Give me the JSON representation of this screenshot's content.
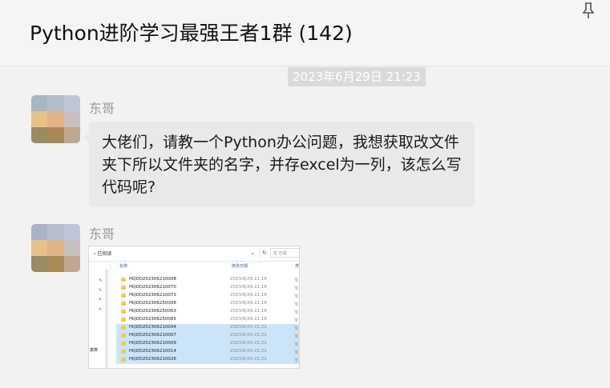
{
  "window": {
    "title": "Python进阶学习最强王者1群 (142)",
    "pin_icon": "pin-icon"
  },
  "timestamp": "2023年6月29日 21:23",
  "messages": [
    {
      "sender": "东哥",
      "avatar_icon": "blurred-avatar",
      "text": "大佬们，请教一个Python办公问题，我想获取改文件夹下所以文件夹的名字，并存excel为一列，该怎么写代码呢?"
    },
    {
      "sender": "东哥",
      "avatar_icon": "blurred-avatar",
      "image": {
        "path": "‹ 已阅读",
        "search_placeholder": "在 已阅",
        "nav_text": "撤算",
        "col_name": "名称",
        "col_date": "修改日期",
        "col_type": "类",
        "rows": [
          {
            "name": "HQDD202306210008",
            "date": "2023/6/29 21:19",
            "type": "文",
            "selected": false
          },
          {
            "name": "HQDD202306210070",
            "date": "2023/6/29 21:19",
            "type": "文",
            "selected": false
          },
          {
            "name": "HQDD202306210073",
            "date": "2023/6/29 21:19",
            "type": "文",
            "selected": false
          },
          {
            "name": "HQDD202306250008",
            "date": "2023/6/29 21:19",
            "type": "文",
            "selected": false
          },
          {
            "name": "HQDD202306250063",
            "date": "2023/6/29 21:19",
            "type": "文",
            "selected": false
          },
          {
            "name": "HQDD202306250065",
            "date": "2023/6/29 21:19",
            "type": "文",
            "selected": false
          },
          {
            "name": "HQDD202306210004",
            "date": "2023/6/29 21:21",
            "type": "文",
            "selected": true
          },
          {
            "name": "HQDD202306210007",
            "date": "2023/6/29 21:21",
            "type": "文",
            "selected": true
          },
          {
            "name": "HQDD202306210009",
            "date": "2023/6/29 21:21",
            "type": "文",
            "selected": true
          },
          {
            "name": "HQDD202306210014",
            "date": "2023/6/29 21:21",
            "type": "文",
            "selected": true
          },
          {
            "name": "HQDD202306210026",
            "date": "2023/6/29 21:21",
            "type": "文",
            "selected": true
          }
        ]
      }
    }
  ],
  "colors": {
    "bubble": "#e9e9e9",
    "selected_row": "#cce4f7",
    "avatar_cells": [
      "#a9b4c4",
      "#b5bfcb",
      "#bcc8d8",
      "#e8c08a",
      "#e0b488",
      "#c9bfbf",
      "#9a8a66",
      "#a98a55",
      "#c0a890"
    ]
  }
}
